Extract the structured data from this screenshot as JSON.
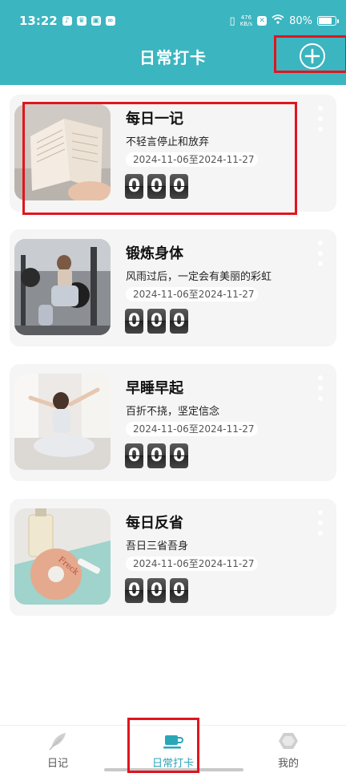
{
  "status_bar": {
    "time": "13:22",
    "net_speed_value": "476",
    "net_speed_unit": "KB/s",
    "battery": "80%",
    "battery_level": 0.8
  },
  "header": {
    "title": "日常打卡",
    "add_icon": "plus-circle-icon"
  },
  "cards": [
    {
      "title": "每日一记",
      "motto": "不轻言停止和放弃",
      "date_range": "2024-11-06至2024-11-27",
      "digits": [
        "0",
        "0",
        "0"
      ]
    },
    {
      "title": "锻炼身体",
      "motto": "风雨过后，一定会有美丽的彩虹",
      "date_range": "2024-11-06至2024-11-27",
      "digits": [
        "0",
        "0",
        "0"
      ]
    },
    {
      "title": "早睡早起",
      "motto": "百折不挠，坚定信念",
      "date_range": "2024-11-06至2024-11-27",
      "digits": [
        "0",
        "0",
        "0"
      ]
    },
    {
      "title": "每日反省",
      "motto": "吾日三省吾身",
      "date_range": "2024-11-06至2024-11-27",
      "digits": [
        "0",
        "0",
        "0"
      ]
    }
  ],
  "cards_more_icon": "more-vertical-icon",
  "thumb_text": "Freck",
  "tabs": [
    {
      "label": "日记",
      "icon": "feather-icon",
      "active": false
    },
    {
      "label": "日常打卡",
      "icon": "coffee-cup-icon",
      "active": true
    },
    {
      "label": "我的",
      "icon": "hexagon-icon",
      "active": false
    }
  ],
  "colors": {
    "header_bg": "#3bb5c0",
    "card_bg": "#f5f5f5",
    "tab_active": "#2aa6b8",
    "annotation_red": "#e0151e"
  }
}
